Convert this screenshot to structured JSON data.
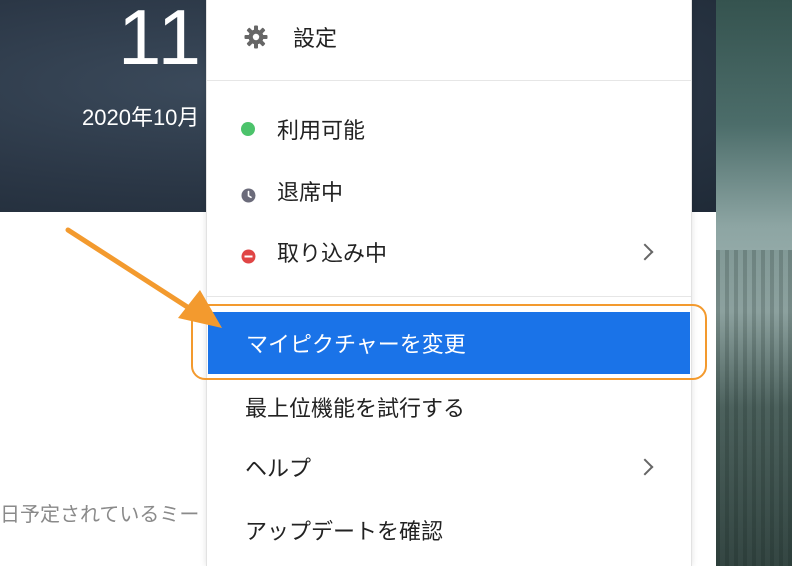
{
  "app": {
    "clock": "11:",
    "date": "2020年10月",
    "meeting_note": "日予定されているミー"
  },
  "menu": {
    "settings": {
      "label": "設定",
      "icon": "gear-icon"
    },
    "status": [
      {
        "label": "利用可能",
        "icon": "available-dot-icon",
        "color": "#4cc36b"
      },
      {
        "label": "退席中",
        "icon": "clock-icon",
        "color": "#6b6b7a"
      },
      {
        "label": "取り込み中",
        "icon": "do-not-disturb-icon",
        "color": "#e04545",
        "submenu": true
      }
    ],
    "actions": [
      {
        "label": "マイピクチャーを変更",
        "selected": true
      },
      {
        "label": "最上位機能を試行する"
      },
      {
        "label": "ヘルプ",
        "submenu": true
      },
      {
        "label": "アップデートを確認"
      }
    ]
  },
  "colors": {
    "selected_bg": "#1a73e8",
    "highlight": "#f39a2e"
  }
}
